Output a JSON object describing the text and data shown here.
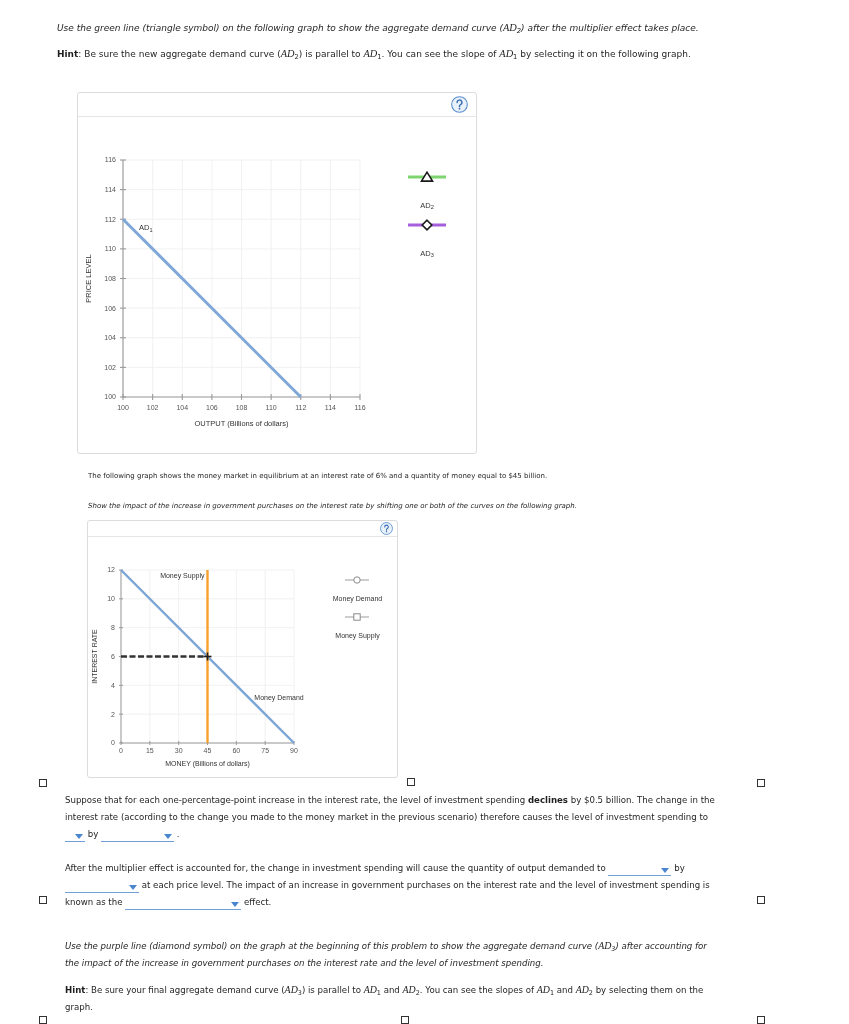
{
  "instructions": [
    {
      "kind": "italic",
      "text": "Use the green line (triangle symbol) on the following graph to show the aggregate demand curve (*AD*$_{2}$) after the multiplier effect takes place."
    },
    {
      "kind": "plain",
      "text": "**Hint**: Be sure the new aggregate demand curve (*AD*$_{2}$) is parallel to *AD*$_{1}$. You can see the slope of *AD*$_{1}$ by selecting it on the following graph."
    }
  ],
  "ad_graph": {
    "chart_data": {
      "type": "line",
      "xlabel": "OUTPUT (Billions of dollars)",
      "ylabel": "PRICE LEVEL",
      "x": [
        100,
        112
      ],
      "series": [
        {
          "name": "AD$_{1}$",
          "color": "#7fa7d8",
          "values": [
            112,
            100
          ]
        }
      ],
      "xlim": [
        100,
        116
      ],
      "ylim": [
        100,
        116
      ],
      "xticks": [
        100,
        102,
        104,
        106,
        108,
        110,
        112,
        114,
        116
      ],
      "yticks": [
        100,
        102,
        104,
        106,
        108,
        110,
        112,
        114,
        116
      ],
      "grid": true
    },
    "palette": [
      {
        "label": "AD$_{2}$",
        "kind": "triangle",
        "color": "#7ed56f"
      },
      {
        "label": "AD$_{3}$",
        "kind": "diamond",
        "color": "#a55fdc"
      }
    ]
  },
  "money_market_text": [
    {
      "kind": "plain",
      "text": "The following graph shows the money market in equilibrium at an interest rate of 6% and a quantity of money equal to $45 billion."
    },
    {
      "kind": "italic",
      "text": "Show the impact of the increase in government purchases on the interest rate by shifting one or both of the curves on the following graph."
    }
  ],
  "money_graph": {
    "chart_data": {
      "type": "line",
      "xlabel": "MONEY (Billions of dollars)",
      "ylabel": "INTEREST RATE",
      "series": [
        {
          "name": "Money Demand",
          "color": "#7ba6d6",
          "x": [
            0,
            90
          ],
          "values": [
            12,
            0
          ]
        },
        {
          "name": "Money Supply",
          "color": "#f7a12c",
          "x": [
            45,
            45
          ],
          "values": [
            0,
            12
          ]
        }
      ],
      "xlim": [
        0,
        90
      ],
      "ylim": [
        0,
        12
      ],
      "xticks": [
        0,
        15,
        30,
        45,
        60,
        75,
        90
      ],
      "yticks": [
        0,
        2,
        4,
        6,
        8,
        10,
        12
      ],
      "grid": true,
      "ref_lines": [
        {
          "axis": "y",
          "value": 6
        }
      ]
    },
    "palette": [
      {
        "label": "Money Demand",
        "kind": "circle"
      },
      {
        "label": "Money Supply",
        "kind": "square"
      }
    ]
  },
  "questions": [
    {
      "segments": [
        {
          "kind": "text",
          "text": "Suppose that for each one-percentage-point increase in the interest rate, the level of investment spending **declines** by $0.5 billion. The change in the interest rate (according to the change you made to the money market in the previous scenario) therefore causes the level of investment spending to"
        },
        {
          "kind": "dropdown"
        },
        {
          "kind": "text",
          "text": "by"
        },
        {
          "kind": "dropdown"
        },
        {
          "kind": "text",
          "text": "."
        }
      ]
    },
    {
      "segments": [
        {
          "kind": "text",
          "text": "After the multiplier effect is accounted for, the change in investment spending will cause the quantity of output demanded to"
        },
        {
          "kind": "dropdown"
        },
        {
          "kind": "text",
          "text": "by"
        },
        {
          "kind": "dropdown"
        },
        {
          "kind": "text",
          "text": "at each price level. The impact of an increase in government purchases on the interest rate and the level of investment spending is"
        },
        {
          "kind": "text",
          "text": "known as the"
        },
        {
          "kind": "dropdown"
        },
        {
          "kind": "text",
          "text": "effect."
        }
      ]
    }
  ],
  "followup": [
    {
      "kind": "italic",
      "text": "Use the purple line (diamond symbol) on the graph at the beginning of this problem to show the aggregate demand curve (*AD*$_{3}$) after accounting for the impact of the increase in government purchases on the interest rate and the level of investment spending."
    },
    {
      "kind": "plain",
      "text": "**Hint**: Be sure your final aggregate demand curve (*AD*$_{3}$) is parallel to *AD*$_{1}$ and *AD*$_{2}$. You can see the slopes of *AD*$_{1}$ and *AD*$_{2}$ by selecting them on the graph."
    }
  ]
}
